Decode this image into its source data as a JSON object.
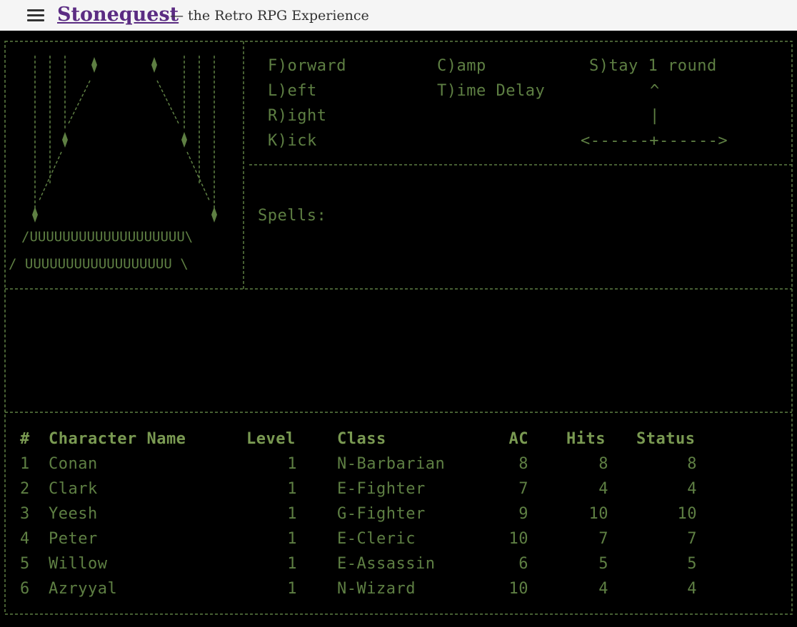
{
  "app": {
    "title": "Stonequest",
    "tagline": "— the Retro RPG Experience",
    "menu_icon": "hamburger-icon"
  },
  "colors": {
    "text": "#5e7f43",
    "header": "#7a9a52",
    "background": "#000000",
    "title": "#5b2c83"
  },
  "commands": {
    "forward": "F)orward",
    "left": "L)eft",
    "right": "R)ight",
    "kick": "K)ick",
    "camp": "C)amp",
    "time_delay": "T)ime Delay",
    "stay": "S)tay 1 round"
  },
  "arrows": {
    "up": "^",
    "stem": "|",
    "line": "<------+------>"
  },
  "spells_label": "Spells:",
  "party": {
    "headers": {
      "num": "#",
      "name": "Character Name",
      "level": "Level",
      "class": "Class",
      "ac": "AC",
      "hits": "Hits",
      "status": "Status"
    },
    "rows": [
      {
        "num": "1",
        "name": "Conan",
        "level": "1",
        "class": "N-Barbarian",
        "ac": "8",
        "hits": "8",
        "status": "8"
      },
      {
        "num": "2",
        "name": "Clark",
        "level": "1",
        "class": "E-Fighter",
        "ac": "7",
        "hits": "4",
        "status": "4"
      },
      {
        "num": "3",
        "name": "Yeesh",
        "level": "1",
        "class": "G-Fighter",
        "ac": "9",
        "hits": "10",
        "status": "10"
      },
      {
        "num": "4",
        "name": "Peter",
        "level": "1",
        "class": "E-Cleric",
        "ac": "10",
        "hits": "7",
        "status": "7"
      },
      {
        "num": "5",
        "name": "Willow",
        "level": "1",
        "class": "E-Assassin",
        "ac": "6",
        "hits": "5",
        "status": "5"
      },
      {
        "num": "6",
        "name": "Azryyal",
        "level": "1",
        "class": "N-Wizard",
        "ac": "10",
        "hits": "4",
        "status": "4"
      }
    ]
  }
}
